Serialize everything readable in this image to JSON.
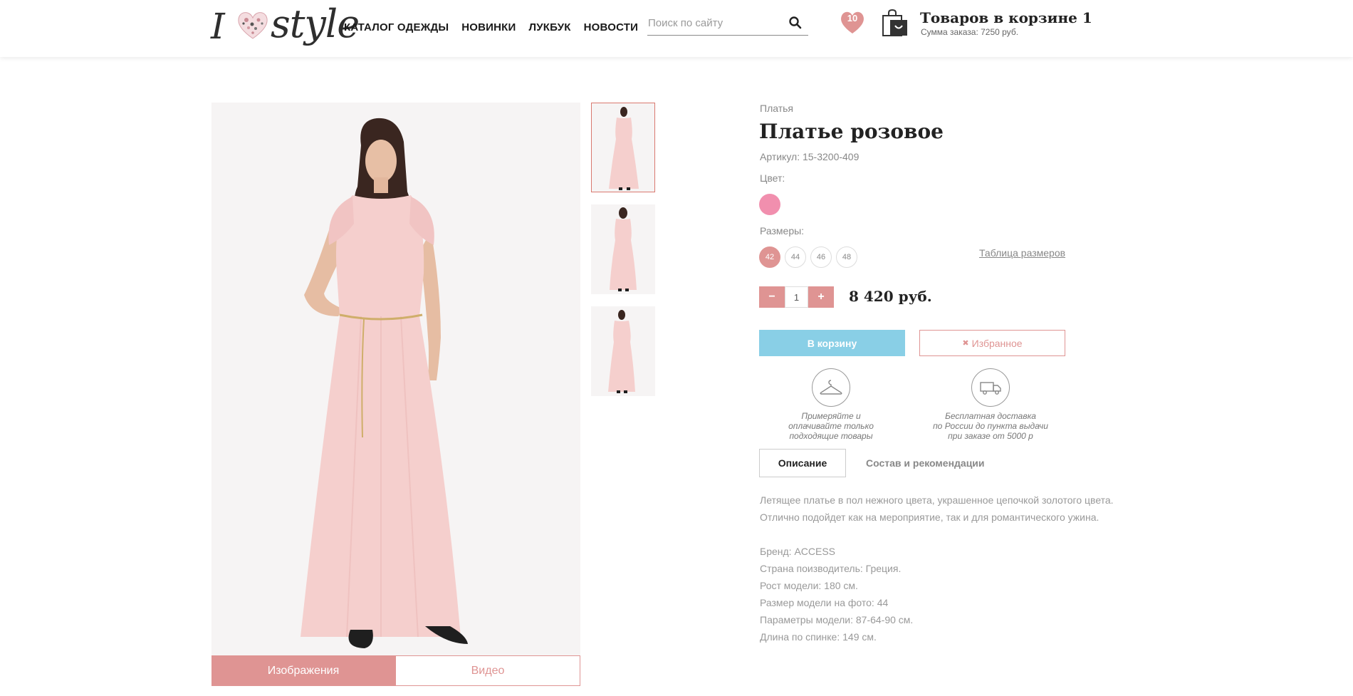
{
  "header": {
    "logo_text_i": "I",
    "logo_text_style": "style",
    "nav": [
      "КАТАЛОГ ОДЕЖДЫ",
      "НОВИНКИ",
      "ЛУКБУК",
      "НОВОСТИ"
    ],
    "search_placeholder": "Поиск по сайту",
    "favorites_count": "10",
    "cart_title": "Товаров в корзине 1",
    "cart_sum": "Сумма заказа: 7250 руб."
  },
  "gallery": {
    "tabs": [
      "Изображения",
      "Видео"
    ],
    "active_tab": "Изображения",
    "thumbnail_count": 3,
    "active_thumbnail": 1
  },
  "product": {
    "category": "Платья",
    "title": "Платье розовое",
    "sku": "Артикул: 15-3200-409",
    "color_label": "Цвет:",
    "color_hex": "#f18fae",
    "sizes_label": "Размеры:",
    "sizes": [
      "42",
      "44",
      "46",
      "48"
    ],
    "selected_size": "42",
    "size_table": "Таблица размеров",
    "qty_minus": "−",
    "qty_plus": "+",
    "quantity": "1",
    "price": "8 420 руб.",
    "add_to_cart": "В корзину",
    "favorite_icon": "✖",
    "favorite": "Избранное"
  },
  "features": [
    {
      "icon": "hanger-icon",
      "lines": [
        "Примеряйте и",
        "оплачивайте только",
        "подходящие товары"
      ]
    },
    {
      "icon": "delivery-truck-icon",
      "lines": [
        "Бесплатная доставка",
        "по России до пункта выдачи",
        "при заказе от 5000 р"
      ]
    }
  ],
  "info_tabs": [
    "Описание",
    "Состав и рекомендации"
  ],
  "description": {
    "para": [
      "Летящее платье в пол нежного цвета, украшенное цепочкой золотого цвета.",
      "Отлично подойдет как на мероприятие, так и для романтического ужина."
    ],
    "details": [
      "Бренд: ACCESS",
      "Страна поизводитель: Греция.",
      "Рост модели: 180 см.",
      "Размер модели на фото: 44",
      "Параметры модели: 87-64-90 см.",
      "Длина по спинке: 149 см."
    ]
  },
  "colors": {
    "accent_pink": "#df9493",
    "button_blue": "#89cfe6",
    "dress_pink": "#f6cfcf"
  }
}
